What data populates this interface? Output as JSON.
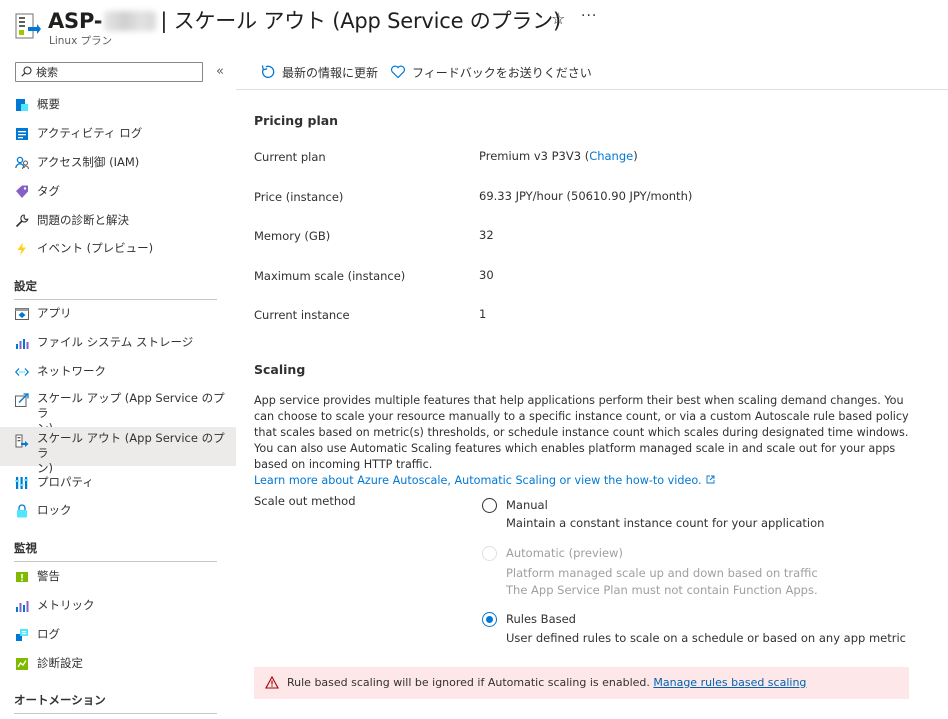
{
  "header": {
    "title_prefix": "ASP-",
    "title_suffix": "| スケール アウト (App Service のプラン)",
    "subtitle": "Linux プラン",
    "favorite_glyph": "☆",
    "more_glyph": "···"
  },
  "sidebar": {
    "search_placeholder": "検索",
    "collapse_glyph": "«",
    "items_top": [
      {
        "label": "概要",
        "icon": "overview-icon"
      },
      {
        "label": "アクティビティ ログ",
        "icon": "activity-log-icon"
      },
      {
        "label": "アクセス制御 (IAM)",
        "icon": "iam-icon"
      },
      {
        "label": "タグ",
        "icon": "tag-icon"
      },
      {
        "label": "問題の診断と解決",
        "icon": "wrench-icon"
      },
      {
        "label": "イベント (プレビュー)",
        "icon": "lightning-icon"
      }
    ],
    "section_settings": "設定",
    "items_settings": [
      {
        "label": "アプリ",
        "icon": "app-icon"
      },
      {
        "label": "ファイル システム ストレージ",
        "icon": "storage-chart-icon"
      },
      {
        "label": "ネットワーク",
        "icon": "network-icon"
      },
      {
        "label_line1": "スケール アップ (App Service のプラ",
        "label_line2": "ン)",
        "icon": "scale-up-icon"
      },
      {
        "label_line1": "スケール アウト (App Service のプラ",
        "label_line2": "ン)",
        "icon": "scale-out-icon",
        "selected": true
      },
      {
        "label": "プロパティ",
        "icon": "properties-icon"
      },
      {
        "label": "ロック",
        "icon": "lock-icon"
      }
    ],
    "section_monitoring": "監視",
    "items_monitoring": [
      {
        "label": "警告",
        "icon": "alert-icon"
      },
      {
        "label": "メトリック",
        "icon": "metrics-icon"
      },
      {
        "label": "ログ",
        "icon": "logs-icon"
      },
      {
        "label": "診断設定",
        "icon": "diagnostic-settings-icon"
      }
    ],
    "section_automation": "オートメーション"
  },
  "toolbar": {
    "refresh_label": "最新の情報に更新",
    "feedback_label": "フィードバックをお送りください"
  },
  "pricing": {
    "heading": "Pricing plan",
    "rows": [
      {
        "label": "Current plan",
        "value": "Premium v3 P3V3 (",
        "link": "Change",
        "tail": ")"
      },
      {
        "label": "Price (instance)",
        "value": "69.33 JPY/hour (50610.90 JPY/month)"
      },
      {
        "label": "Memory (GB)",
        "value": "32"
      },
      {
        "label": "Maximum scale (instance)",
        "value": "30"
      },
      {
        "label": "Current instance",
        "value": "1"
      }
    ]
  },
  "scaling": {
    "heading": "Scaling",
    "description": "App service provides multiple features that help applications perform their best when scaling demand changes. You can choose to scale your resource manually to a specific instance count, or via a custom Autoscale rule based policy that scales based on metric(s) thresholds, or schedule instance count which scales during designated time windows. You can also use Automatic Scaling features which enables platform managed scale in and scale out for your apps based on incoming HTTP traffic.",
    "learn_more": "Learn more about Azure Autoscale, Automatic Scaling or view the how-to video.",
    "method_label": "Scale out method",
    "options": {
      "manual": {
        "label": "Manual",
        "desc": "Maintain a constant instance count for your application"
      },
      "automatic": {
        "label": "Automatic (preview)",
        "desc1": "Platform managed scale up and down based on traffic",
        "desc2": "The App Service Plan must not contain Function Apps."
      },
      "rules": {
        "label": "Rules Based",
        "desc": "User defined rules to scale on a schedule or based on any app metric"
      }
    },
    "selected_option": "Rules Based"
  },
  "warning": {
    "text": "Rule based scaling will be ignored if Automatic scaling is enabled.",
    "link": "Manage rules based scaling"
  },
  "colors": {
    "accent": "#0078d4",
    "warning_bg": "#fde7e9",
    "selected_nav_bg": "#edebe9"
  }
}
